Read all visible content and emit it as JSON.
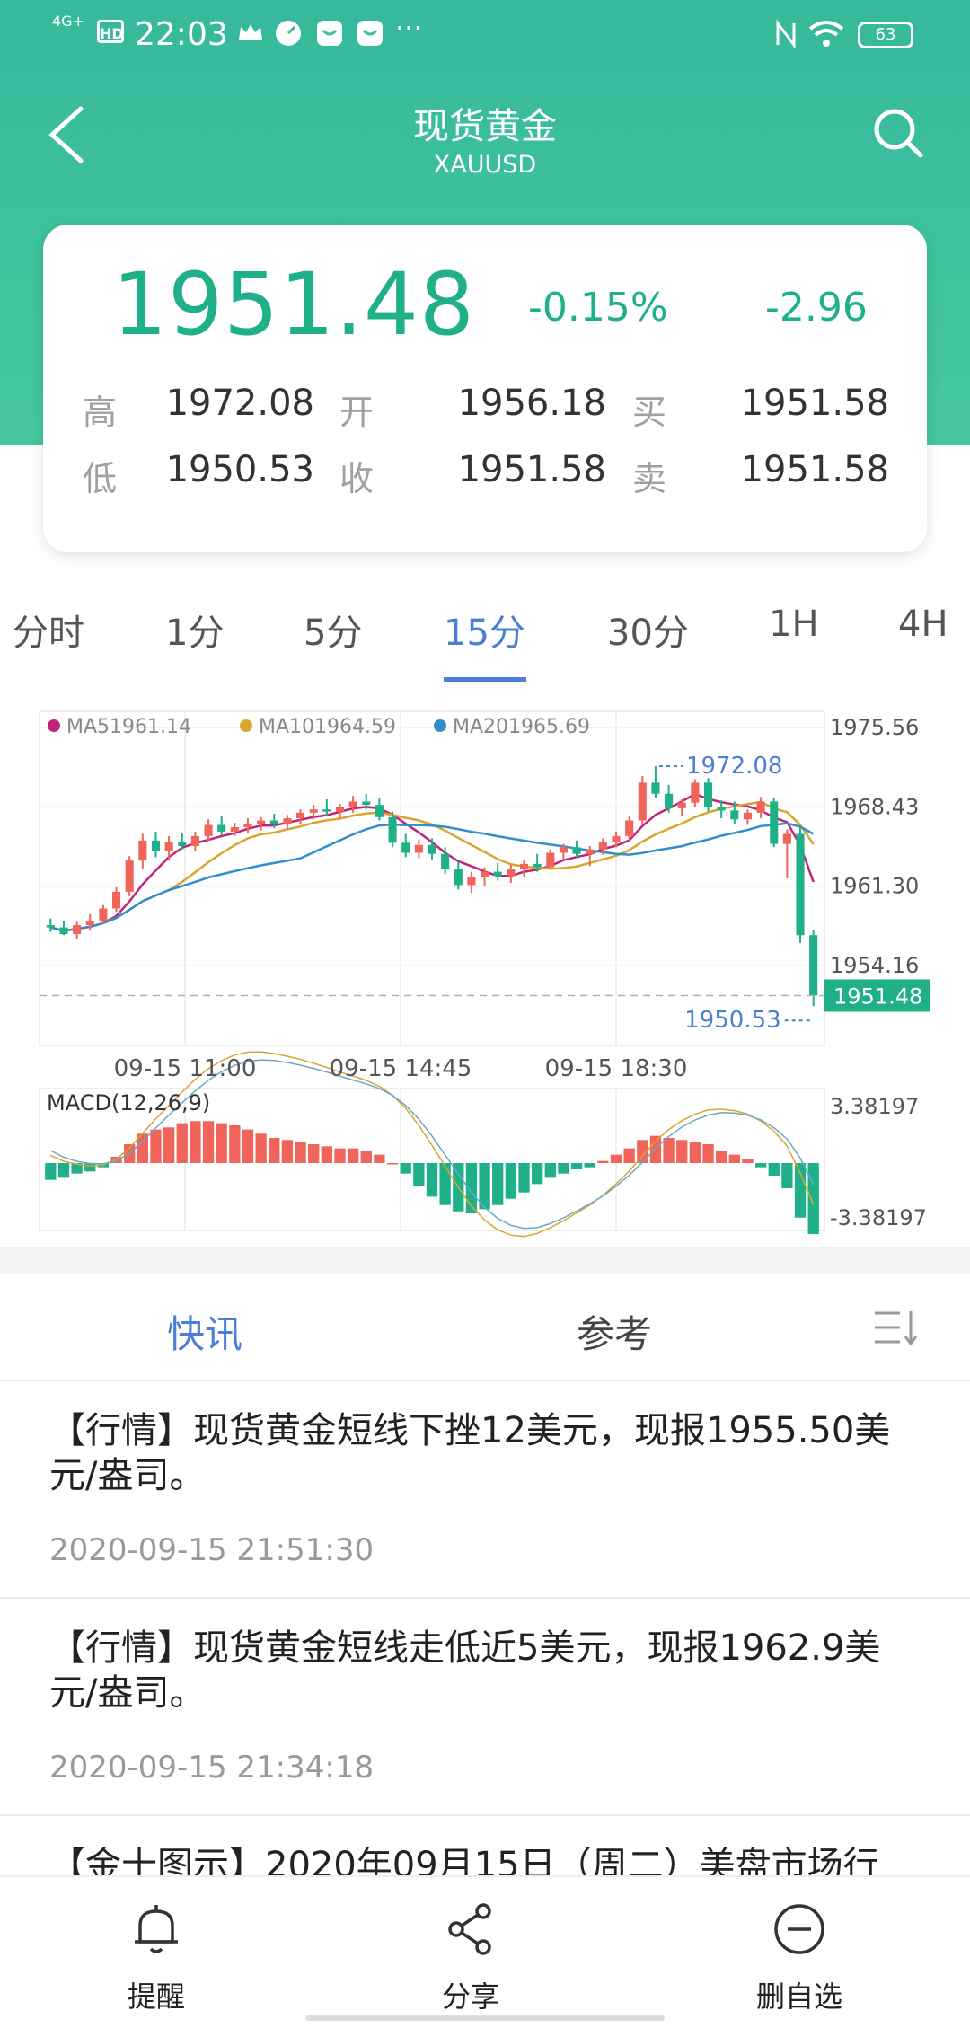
{
  "status_bar": {
    "network": "4G+",
    "hd": "HD",
    "time": "22:03",
    "more": "···",
    "battery": "63"
  },
  "header": {
    "title": "现货黄金",
    "symbol": "XAUUSD"
  },
  "quote": {
    "price": "1951.48",
    "change_pct": "-0.15%",
    "change": "-2.96",
    "rows": [
      {
        "l1": "高",
        "v1": "1972.08",
        "l2": "开",
        "v2": "1956.18",
        "l3": "买",
        "v3": "1951.58"
      },
      {
        "l1": "低",
        "v1": "1950.53",
        "l2": "收",
        "v2": "1951.58",
        "l3": "卖",
        "v3": "1951.58"
      }
    ],
    "up_color": "#f0645a",
    "down_color": "#1fb08a"
  },
  "timeframes": [
    "分时",
    "1分",
    "5分",
    "15分",
    "30分",
    "1H",
    "4H"
  ],
  "active_timeframe": "15分",
  "chart_data": {
    "type": "candlestick",
    "legend": [
      {
        "name": "MA5",
        "value": "1961.14",
        "color": "#c2237a"
      },
      {
        "name": "MA10",
        "value": "1964.59",
        "color": "#d9a52c"
      },
      {
        "name": "MA20",
        "value": "1965.69",
        "color": "#2f8fce"
      }
    ],
    "y_ticks": [
      "1975.56",
      "1968.43",
      "1961.30",
      "1954.16"
    ],
    "ylim": [
      1947.0,
      1977.0
    ],
    "current_price": "1951.48",
    "high_marker": "1972.08",
    "low_marker": "1950.53",
    "x_ticks": [
      "09-15 11:00",
      "09-15 14:45",
      "09-15 18:30"
    ],
    "candles": [
      [
        1957.8,
        1958.4,
        1957.2,
        1957.6
      ],
      [
        1957.6,
        1958.2,
        1956.9,
        1957.0
      ],
      [
        1957.0,
        1958.1,
        1956.6,
        1957.8
      ],
      [
        1957.8,
        1958.8,
        1957.3,
        1958.2
      ],
      [
        1958.2,
        1959.6,
        1957.9,
        1959.3
      ],
      [
        1959.3,
        1961.2,
        1959.0,
        1960.8
      ],
      [
        1960.8,
        1964.0,
        1960.4,
        1963.6
      ],
      [
        1963.6,
        1966.0,
        1962.8,
        1965.4
      ],
      [
        1965.4,
        1966.2,
        1963.9,
        1964.5
      ],
      [
        1964.5,
        1965.8,
        1963.6,
        1965.3
      ],
      [
        1965.3,
        1966.1,
        1964.6,
        1964.9
      ],
      [
        1964.9,
        1966.2,
        1964.5,
        1965.8
      ],
      [
        1965.8,
        1967.3,
        1965.4,
        1966.8
      ],
      [
        1966.8,
        1967.6,
        1965.9,
        1966.2
      ],
      [
        1966.2,
        1967.0,
        1965.8,
        1966.6
      ],
      [
        1966.6,
        1967.4,
        1966.1,
        1966.9
      ],
      [
        1966.9,
        1967.5,
        1966.3,
        1967.2
      ],
      [
        1967.2,
        1967.8,
        1966.5,
        1966.9
      ],
      [
        1966.9,
        1967.7,
        1966.4,
        1967.4
      ],
      [
        1967.4,
        1968.2,
        1966.9,
        1967.9
      ],
      [
        1967.9,
        1968.6,
        1967.3,
        1968.2
      ],
      [
        1968.2,
        1969.1,
        1967.6,
        1968.0
      ],
      [
        1968.0,
        1968.7,
        1967.3,
        1968.4
      ],
      [
        1968.4,
        1969.4,
        1967.9,
        1968.9
      ],
      [
        1968.9,
        1969.6,
        1968.2,
        1968.6
      ],
      [
        1968.6,
        1969.2,
        1967.2,
        1967.5
      ],
      [
        1967.5,
        1968.0,
        1964.8,
        1965.2
      ],
      [
        1965.2,
        1966.0,
        1963.9,
        1964.3
      ],
      [
        1964.3,
        1965.5,
        1963.8,
        1965.0
      ],
      [
        1965.0,
        1965.6,
        1963.7,
        1964.2
      ],
      [
        1964.2,
        1964.8,
        1962.4,
        1962.8
      ],
      [
        1962.8,
        1963.5,
        1961.0,
        1961.4
      ],
      [
        1961.4,
        1962.6,
        1960.7,
        1962.1
      ],
      [
        1962.1,
        1963.0,
        1961.3,
        1962.6
      ],
      [
        1962.6,
        1963.4,
        1961.8,
        1962.2
      ],
      [
        1962.2,
        1963.2,
        1961.6,
        1962.8
      ],
      [
        1962.8,
        1963.6,
        1962.1,
        1963.3
      ],
      [
        1963.3,
        1964.2,
        1962.6,
        1963.0
      ],
      [
        1963.0,
        1964.6,
        1962.8,
        1964.3
      ],
      [
        1964.3,
        1965.1,
        1963.6,
        1964.8
      ],
      [
        1964.8,
        1965.4,
        1963.9,
        1964.2
      ],
      [
        1964.2,
        1964.9,
        1963.1,
        1964.6
      ],
      [
        1964.6,
        1965.6,
        1964.1,
        1965.3
      ],
      [
        1965.3,
        1966.2,
        1964.8,
        1965.8
      ],
      [
        1965.8,
        1967.6,
        1965.4,
        1967.2
      ],
      [
        1967.2,
        1971.2,
        1966.8,
        1970.6
      ],
      [
        1970.6,
        1972.08,
        1969.2,
        1969.6
      ],
      [
        1969.6,
        1970.4,
        1967.9,
        1968.3
      ],
      [
        1968.3,
        1969.1,
        1967.6,
        1968.8
      ],
      [
        1968.8,
        1970.9,
        1968.4,
        1970.6
      ],
      [
        1970.6,
        1971.0,
        1968.0,
        1968.4
      ],
      [
        1968.4,
        1969.0,
        1967.4,
        1968.1
      ],
      [
        1968.1,
        1968.9,
        1966.9,
        1967.3
      ],
      [
        1967.3,
        1968.2,
        1966.8,
        1967.9
      ],
      [
        1967.9,
        1969.3,
        1967.4,
        1968.9
      ],
      [
        1968.9,
        1969.2,
        1964.8,
        1965.1
      ],
      [
        1965.1,
        1966.4,
        1962.0,
        1966.0
      ],
      [
        1966.0,
        1966.6,
        1956.2,
        1956.9
      ],
      [
        1956.9,
        1957.4,
        1950.53,
        1951.48
      ]
    ],
    "macd_ticks": [
      "3.38197",
      "-3.38197"
    ],
    "macd_label": "MACD(12,26,9)",
    "macd_hist": [
      -0.8,
      -0.7,
      -0.5,
      -0.4,
      -0.2,
      0.3,
      0.9,
      1.4,
      1.6,
      1.7,
      1.9,
      2.0,
      2.0,
      1.9,
      1.8,
      1.6,
      1.4,
      1.2,
      1.1,
      1.0,
      0.9,
      0.8,
      0.7,
      0.7,
      0.6,
      0.4,
      0.0,
      -0.5,
      -1.1,
      -1.6,
      -2.0,
      -2.3,
      -2.4,
      -2.2,
      -2.0,
      -1.7,
      -1.4,
      -1.0,
      -0.7,
      -0.5,
      -0.3,
      -0.2,
      0.1,
      0.4,
      0.7,
      1.1,
      1.3,
      1.2,
      1.1,
      1.0,
      0.9,
      0.6,
      0.4,
      0.2,
      -0.2,
      -0.6,
      -1.2,
      -2.6,
      -3.38
    ]
  },
  "news_tabs": [
    "快讯",
    "参考"
  ],
  "news": [
    {
      "text": "【行情】现货黄金短线下挫12美元，现报1955.50美元/盎司。",
      "time": "2020-09-15 21:51:30"
    },
    {
      "text": "【行情】现货黄金短线走低近5美元，现报1962.9美元/盎司。",
      "time": "2020-09-15 21:34:18"
    },
    {
      "text": "【金十图示】2020年09月15日（周二）美盘市场行",
      "time": ""
    }
  ],
  "bottom_nav": [
    {
      "icon": "bell-icon",
      "label": "提醒"
    },
    {
      "icon": "share-icon",
      "label": "分享"
    },
    {
      "icon": "minus-circle-icon",
      "label": "删自选"
    }
  ]
}
